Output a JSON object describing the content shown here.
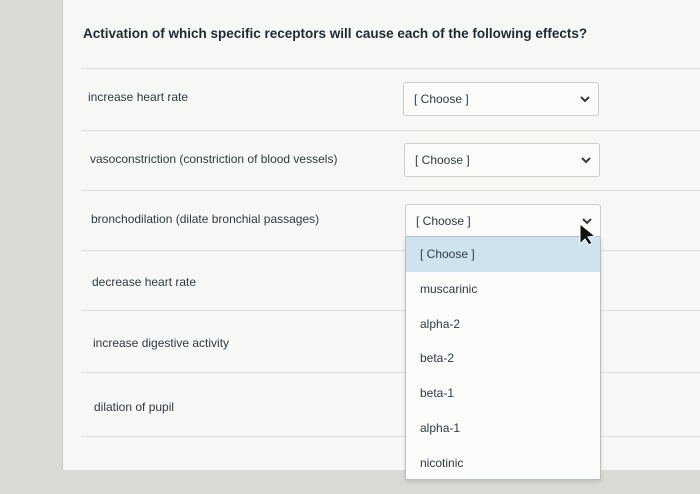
{
  "question": "Activation of which specific receptors will cause each of the following effects?",
  "rows": [
    {
      "label": "increase heart rate",
      "selected": "[ Choose ]"
    },
    {
      "label": "vasoconstriction (constriction of blood vessels)",
      "selected": "[ Choose ]"
    },
    {
      "label": "bronchodilation (dilate bronchial passages)",
      "selected": "[ Choose ]"
    },
    {
      "label": "decrease heart rate"
    },
    {
      "label": "increase digestive activity"
    },
    {
      "label": "dilation of pupil"
    }
  ],
  "dropdown_options": [
    "[ Choose ]",
    "muscarinic",
    "alpha-2",
    "beta-2",
    "beta-1",
    "alpha-1",
    "nicotinic"
  ],
  "highlighted_option": "[ Choose ]",
  "colors": {
    "highlight": "#cfe3ef",
    "text": "#2d3b45",
    "chevron": "#3a3a3a"
  },
  "icons": {
    "select_chevron": "chevron-down-icon",
    "pointer": "mouse-cursor-icon"
  }
}
